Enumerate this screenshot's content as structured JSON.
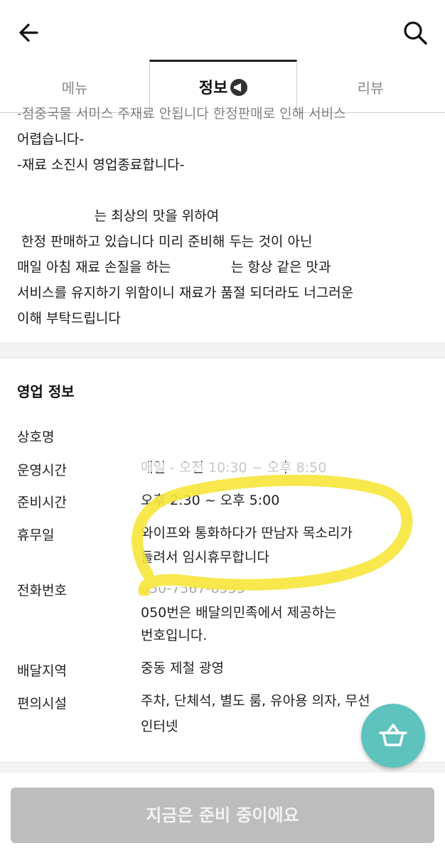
{
  "tabs": {
    "menu": "메뉴",
    "info": "정보",
    "review": "리뷰"
  },
  "notice_lines": [
    "-점중국물 서미스 주재료 안됩니다 한정판매로 인해 서비스",
    "어렵습니다-",
    "-재료 소진시 영업종료합니다-",
    "",
    "                  는 최상의 맛을 위하여",
    " 한정 판매하고 있습니다 미리 준비해 두는 것이 아닌",
    "매일 아침 재료 손질을 하는              는 항상 같은 맛과",
    "서비스를 유지하기 위함이니 재료가 품절 되더라도 너그러운",
    "이해 부탁드립니다"
  ],
  "business": {
    "title": "영업 정보",
    "rows": [
      {
        "label": "상호명",
        "value": ""
      },
      {
        "label": "운영시간",
        "value": "매일 - 오전 10:30 ~ 오후 8:50"
      },
      {
        "label": "준비시간",
        "value": "오후 2:30 ~ 오후 5:00"
      },
      {
        "label": "휴무일",
        "value": "와이프와 통화하다가 딴남자 목소리가",
        "value2": "들려서  임시휴무합니다"
      },
      {
        "label": "전화번호",
        "value": "050-7567-6535",
        "value2": "050번은 배달의민족에서 제공하는",
        "value3": "번호입니다."
      },
      {
        "label": "배달지역",
        "value": "중동 제철 광영"
      },
      {
        "label": "편의시설",
        "value": "주차, 단체석, 별도 룸, 유아용 의자, 무선",
        "value2": "인터넷"
      }
    ]
  },
  "order_button": "지금은 준비 중이에요",
  "colors": {
    "fab": "#5fc3bd",
    "highlight": "#f7e53a",
    "order_disabled": "#bdbdbd"
  },
  "icons": {
    "back": "arrow-left-icon",
    "search": "search-icon",
    "badge": "megaphone-icon",
    "basket": "basket-icon"
  }
}
